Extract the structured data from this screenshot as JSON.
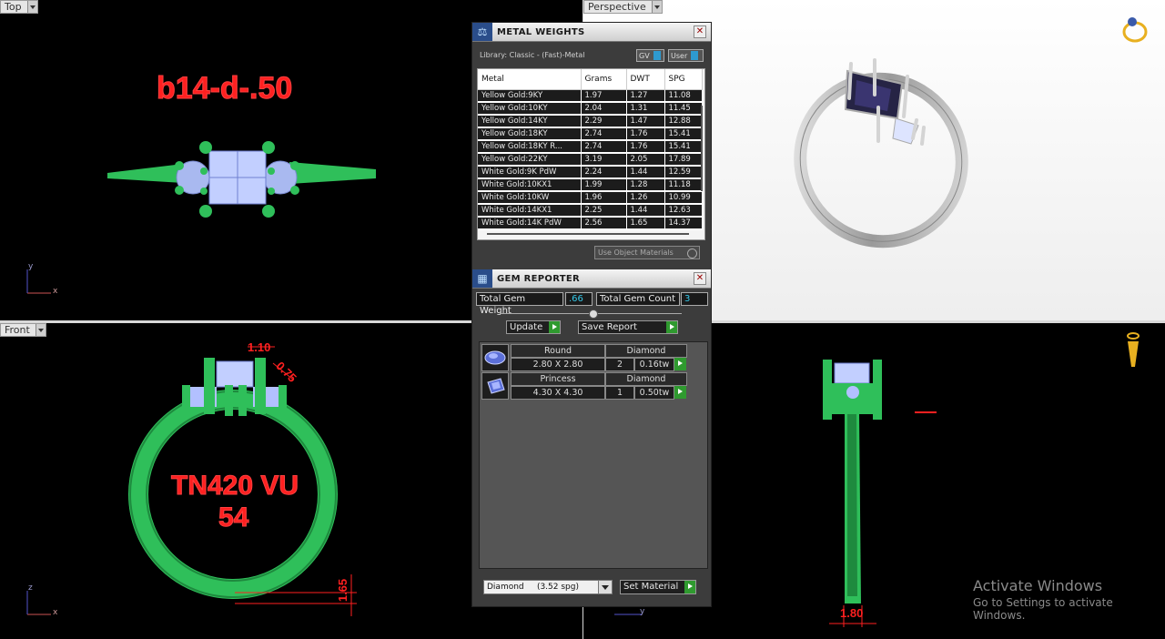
{
  "viewports": {
    "top": {
      "label": "Top",
      "model_text": "b14-d-.50",
      "axis_x": "x",
      "axis_y": "y"
    },
    "perspective": {
      "label": "Perspective"
    },
    "front": {
      "label": "Front",
      "engraving_line1": "TN420 VU",
      "engraving_line2": "54",
      "dim_top": "1.10",
      "dim_side": "0.75",
      "dim_band": "1.65",
      "axis_x": "x",
      "axis_z": "z"
    },
    "right": {
      "dim_bottom": "1.80",
      "axis_y": "y"
    }
  },
  "metal_weights": {
    "title": "METAL WEIGHTS",
    "library": "Library: Classic - (Fast)-Metal",
    "toggle_gv": "GV",
    "toggle_user": "User",
    "columns": [
      "Metal",
      "Grams",
      "DWT",
      "SPG"
    ],
    "rows": [
      [
        "Yellow Gold:9KY",
        "1.97",
        "1.27",
        "11.08"
      ],
      [
        "Yellow Gold:10KY",
        "2.04",
        "1.31",
        "11.45"
      ],
      [
        "Yellow Gold:14KY",
        "2.29",
        "1.47",
        "12.88"
      ],
      [
        "Yellow Gold:18KY",
        "2.74",
        "1.76",
        "15.41"
      ],
      [
        "Yellow Gold:18KY R...",
        "2.74",
        "1.76",
        "15.41"
      ],
      [
        "Yellow Gold:22KY",
        "3.19",
        "2.05",
        "17.89"
      ],
      [
        "White Gold:9K PdW",
        "2.24",
        "1.44",
        "12.59"
      ],
      [
        "White Gold:10KX1",
        "1.99",
        "1.28",
        "11.18"
      ],
      [
        "White Gold:10KW",
        "1.96",
        "1.26",
        "10.99"
      ],
      [
        "White Gold:14KX1",
        "2.25",
        "1.44",
        "12.63"
      ],
      [
        "White Gold:14K PdW",
        "2.56",
        "1.65",
        "14.37"
      ]
    ],
    "use_object_materials": "Use Object Materials"
  },
  "gem_reporter": {
    "title": "GEM REPORTER",
    "total_weight_label": "Total Gem Weight",
    "total_weight_value": ".66",
    "total_count_label": "Total Gem Count",
    "total_count_value": "3",
    "update_label": "Update",
    "save_report_label": "Save Report",
    "gems": [
      {
        "shape": "Round",
        "material": "Diamond",
        "size": "2.80 X 2.80",
        "count": "2",
        "weight": "0.16tw"
      },
      {
        "shape": "Princess",
        "material": "Diamond",
        "size": "4.30 X 4.30",
        "count": "1",
        "weight": "0.50tw"
      }
    ],
    "material_select": "Diamond     (3.52 spg)",
    "set_material_label": "Set Material"
  },
  "watermark": {
    "line1": "Activate Windows",
    "line2": "Go to Settings to activate Windows."
  },
  "colors": {
    "model_green": "#2fbf5a",
    "stone_blue": "#b9c8ff",
    "dimension_red": "#ff2020",
    "panel_bg": "#3c3c3c",
    "value_cyan": "#35c8e8"
  }
}
